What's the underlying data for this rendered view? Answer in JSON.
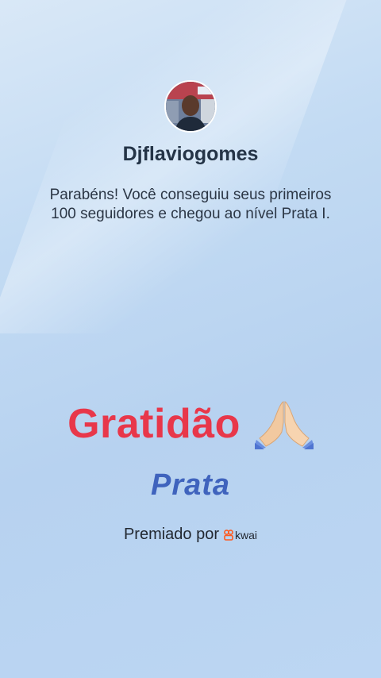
{
  "profile": {
    "username": "Djflaviogomes"
  },
  "message": "Parabéns! Você conseguiu seus primeiros 100 seguidores e chegou ao nível Prata I.",
  "headline": "Gratidão",
  "level": "Prata",
  "award": {
    "label": "Premiado por",
    "brand": "kwai"
  },
  "colors": {
    "headline": "#e8374a",
    "level": "#3f63bd",
    "brand_icon": "#ff5a1f"
  },
  "icons": {
    "headline_emoji": "folded-hands-icon",
    "brand_logo": "kwai-logo-icon"
  }
}
